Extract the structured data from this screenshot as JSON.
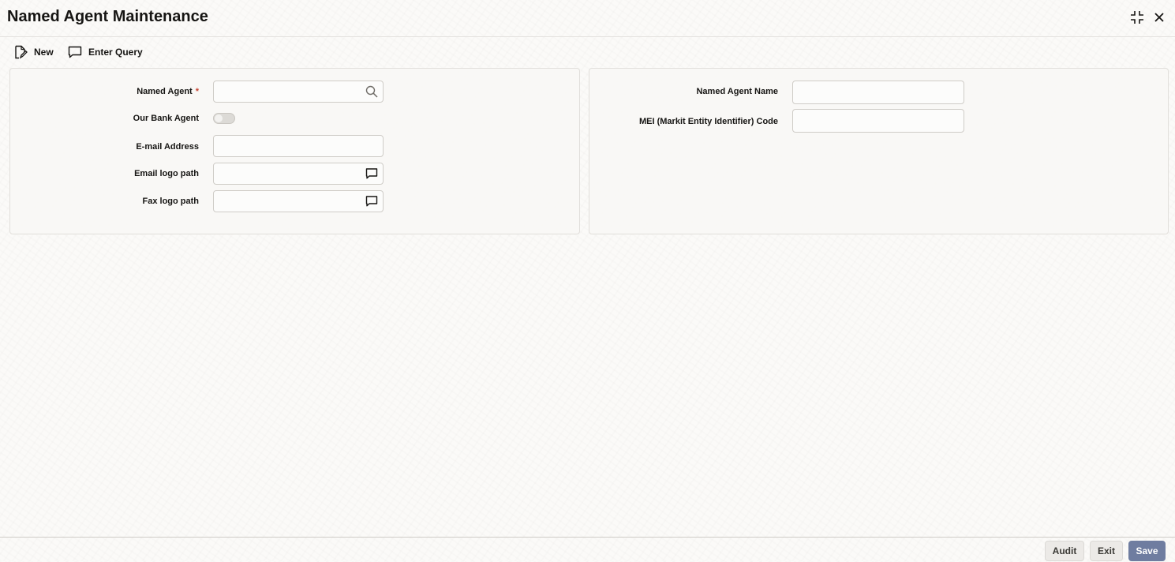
{
  "window": {
    "title": "Named Agent Maintenance",
    "icons": [
      "collapse-icon",
      "close-icon"
    ]
  },
  "toolbar": {
    "new_label": "New",
    "enter_query_label": "Enter Query"
  },
  "left_panel": {
    "named_agent_label": "Named Agent",
    "required_marker": "*",
    "named_agent_value": "",
    "our_bank_agent_label": "Our Bank Agent",
    "our_bank_agent_on": false,
    "email_address_label": "E-mail Address",
    "email_address_value": "",
    "email_logo_path_label": "Email logo path",
    "email_logo_path_value": "",
    "fax_logo_path_label": "Fax logo path",
    "fax_logo_path_value": ""
  },
  "right_panel": {
    "named_agent_name_label": "Named Agent Name",
    "named_agent_name_value": "",
    "mei_code_label": "MEI (Markit Entity Identifier) Code",
    "mei_code_value": ""
  },
  "footer": {
    "audit_label": "Audit",
    "exit_label": "Exit",
    "save_label": "Save"
  },
  "colors": {
    "primary_button": "#6f7da0",
    "required": "#c74634"
  }
}
